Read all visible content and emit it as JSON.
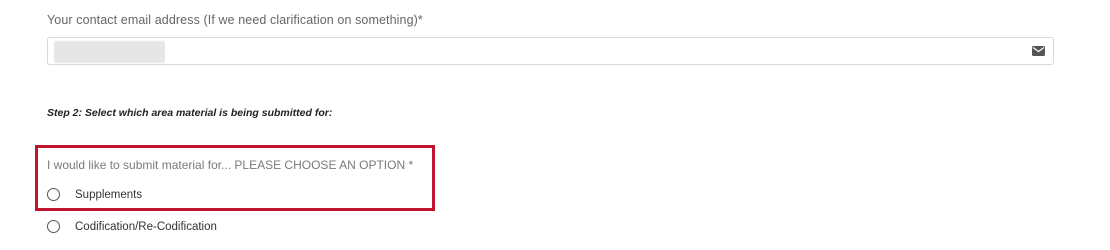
{
  "email": {
    "label": "Your contact email address (If we need clarification on something)*",
    "value": "",
    "icon": "envelope-icon"
  },
  "step2": {
    "heading": "Step 2: Select which area material is being submitted for:"
  },
  "question": {
    "label": "I would like to submit material for... PLEASE CHOOSE AN OPTION *",
    "options": [
      {
        "label": "Supplements",
        "selected": false
      },
      {
        "label": "Codification/Re-Codification",
        "selected": false
      }
    ]
  },
  "colors": {
    "highlight": "#c0152f",
    "field_border": "#d9d9d9"
  }
}
